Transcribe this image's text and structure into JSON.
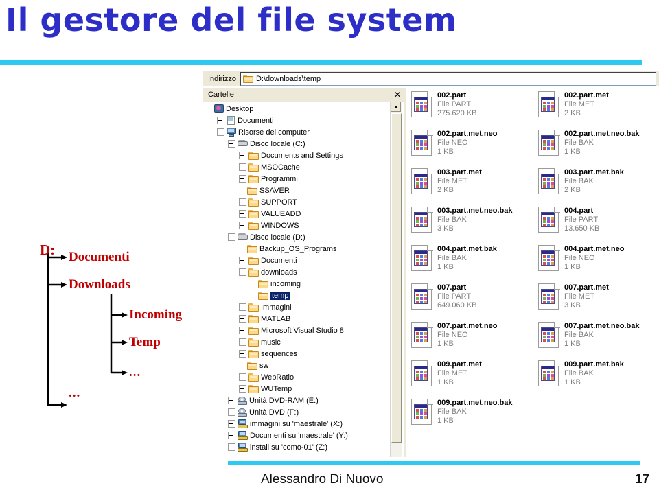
{
  "slide": {
    "title": "Il gestore del file system",
    "footer_author": "Alessandro Di Nuovo",
    "footer_page": "17",
    "accent_color": "#2ec9f0",
    "title_color": "#2d2dc8",
    "diagram_color": "#c00000"
  },
  "diagram": {
    "root": "D:",
    "documenti": "Documenti",
    "downloads": "Downloads",
    "incoming": "Incoming",
    "temp": "Temp",
    "dots_sub": "...",
    "dots_root": "..."
  },
  "explorer": {
    "address": {
      "label": "Indirizzo",
      "value": "D:\\downloads\\temp",
      "icon": "folder-icon"
    },
    "folders_pane": {
      "title": "Cartelle",
      "close_icon": "close-icon"
    },
    "tree": [
      {
        "label": "Desktop",
        "depth": 0,
        "icon": "desktop-icon",
        "expander": "none"
      },
      {
        "label": "Documenti",
        "depth": 1,
        "icon": "documents-icon",
        "expander": "plus"
      },
      {
        "label": "Risorse del computer",
        "depth": 1,
        "icon": "computer-icon",
        "expander": "minus"
      },
      {
        "label": "Disco locale (C:)",
        "depth": 2,
        "icon": "harddisk-icon",
        "expander": "minus"
      },
      {
        "label": "Documents and Settings",
        "depth": 3,
        "icon": "folder-icon",
        "expander": "plus"
      },
      {
        "label": "MSOCache",
        "depth": 3,
        "icon": "folder-icon",
        "expander": "plus"
      },
      {
        "label": "Programmi",
        "depth": 3,
        "icon": "folder-icon",
        "expander": "plus"
      },
      {
        "label": "SSAVER",
        "depth": 3,
        "icon": "folder-icon",
        "expander": "none"
      },
      {
        "label": "SUPPORT",
        "depth": 3,
        "icon": "folder-icon",
        "expander": "plus"
      },
      {
        "label": "VALUEADD",
        "depth": 3,
        "icon": "folder-icon",
        "expander": "plus"
      },
      {
        "label": "WINDOWS",
        "depth": 3,
        "icon": "folder-icon",
        "expander": "plus"
      },
      {
        "label": "Disco locale (D:)",
        "depth": 2,
        "icon": "harddisk-icon",
        "expander": "minus"
      },
      {
        "label": "Backup_OS_Programs",
        "depth": 3,
        "icon": "folder-icon",
        "expander": "none"
      },
      {
        "label": "Documenti",
        "depth": 3,
        "icon": "folder-icon",
        "expander": "plus"
      },
      {
        "label": "downloads",
        "depth": 3,
        "icon": "folder-icon",
        "expander": "minus"
      },
      {
        "label": "incoming",
        "depth": 4,
        "icon": "folder-icon",
        "expander": "none"
      },
      {
        "label": "temp",
        "depth": 4,
        "icon": "folder-icon",
        "expander": "none",
        "selected": true
      },
      {
        "label": "Immagini",
        "depth": 3,
        "icon": "folder-icon",
        "expander": "plus"
      },
      {
        "label": "MATLAB",
        "depth": 3,
        "icon": "folder-icon",
        "expander": "plus"
      },
      {
        "label": "Microsoft Visual Studio 8",
        "depth": 3,
        "icon": "folder-icon",
        "expander": "plus"
      },
      {
        "label": "music",
        "depth": 3,
        "icon": "folder-icon",
        "expander": "plus"
      },
      {
        "label": "sequences",
        "depth": 3,
        "icon": "folder-icon",
        "expander": "plus"
      },
      {
        "label": "sw",
        "depth": 3,
        "icon": "folder-icon",
        "expander": "none"
      },
      {
        "label": "WebRatio",
        "depth": 3,
        "icon": "folder-icon",
        "expander": "plus"
      },
      {
        "label": "WUTemp",
        "depth": 3,
        "icon": "folder-icon",
        "expander": "plus"
      },
      {
        "label": "Unità DVD-RAM (E:)",
        "depth": 2,
        "icon": "dvd-icon",
        "expander": "plus"
      },
      {
        "label": "Unità DVD (F:)",
        "depth": 2,
        "icon": "dvd-icon",
        "expander": "plus"
      },
      {
        "label": "immagini su 'maestrale' (X:)",
        "depth": 2,
        "icon": "network-drive-icon",
        "expander": "plus"
      },
      {
        "label": "Documenti su 'maestrale' (Y:)",
        "depth": 2,
        "icon": "network-drive-icon",
        "expander": "plus"
      },
      {
        "label": "install su 'como-01' (Z:)",
        "depth": 2,
        "icon": "network-drive-icon",
        "expander": "plus"
      }
    ],
    "files": [
      {
        "name": "002.part",
        "type": "File PART",
        "size": "275.620 KB",
        "col": 0,
        "row": 0
      },
      {
        "name": "002.part.met",
        "type": "File MET",
        "size": "2 KB",
        "col": 1,
        "row": 0
      },
      {
        "name": "002.part.met.neo",
        "type": "File NEO",
        "size": "1 KB",
        "col": 0,
        "row": 1
      },
      {
        "name": "002.part.met.neo.bak",
        "type": "File BAK",
        "size": "1 KB",
        "col": 1,
        "row": 1
      },
      {
        "name": "003.part.met",
        "type": "File MET",
        "size": "2 KB",
        "col": 0,
        "row": 2
      },
      {
        "name": "003.part.met.bak",
        "type": "File BAK",
        "size": "2 KB",
        "col": 1,
        "row": 2
      },
      {
        "name": "003.part.met.neo.bak",
        "type": "File BAK",
        "size": "3 KB",
        "col": 0,
        "row": 3
      },
      {
        "name": "004.part",
        "type": "File PART",
        "size": "13.650 KB",
        "col": 1,
        "row": 3
      },
      {
        "name": "004.part.met.bak",
        "type": "File BAK",
        "size": "1 KB",
        "col": 0,
        "row": 4
      },
      {
        "name": "004.part.met.neo",
        "type": "File NEO",
        "size": "1 KB",
        "col": 1,
        "row": 4
      },
      {
        "name": "007.part",
        "type": "File PART",
        "size": "649.060 KB",
        "col": 0,
        "row": 5
      },
      {
        "name": "007.part.met",
        "type": "File MET",
        "size": "3 KB",
        "col": 1,
        "row": 5
      },
      {
        "name": "007.part.met.neo",
        "type": "File NEO",
        "size": "1 KB",
        "col": 0,
        "row": 6
      },
      {
        "name": "007.part.met.neo.bak",
        "type": "File BAK",
        "size": "1 KB",
        "col": 1,
        "row": 6
      },
      {
        "name": "009.part.met",
        "type": "File MET",
        "size": "1 KB",
        "col": 0,
        "row": 7
      },
      {
        "name": "009.part.met.bak",
        "type": "File BAK",
        "size": "1 KB",
        "col": 1,
        "row": 7
      },
      {
        "name": "009.part.met.neo.bak",
        "type": "File BAK",
        "size": "1 KB",
        "col": 0,
        "row": 8
      }
    ]
  }
}
